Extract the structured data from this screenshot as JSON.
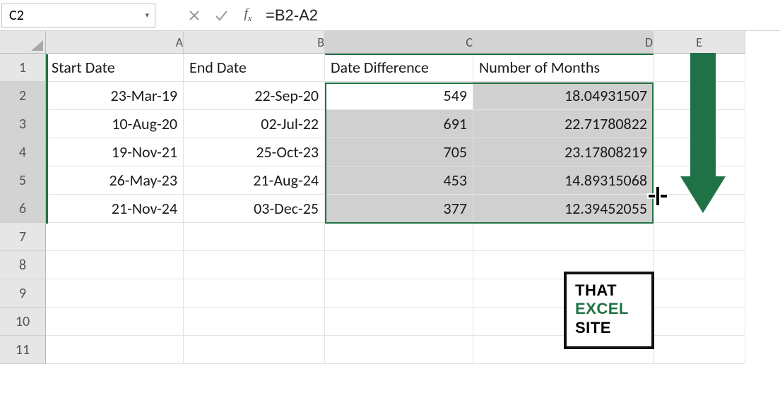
{
  "formula_bar": {
    "cell_ref": "C2",
    "formula": "=B2-A2"
  },
  "columns": [
    "A",
    "B",
    "C",
    "D",
    "E"
  ],
  "row_numbers": [
    "1",
    "2",
    "3",
    "4",
    "5",
    "6",
    "7",
    "8",
    "9",
    "10",
    "11"
  ],
  "headers": {
    "A": "Start Date",
    "B": "End Date",
    "C": "Date Difference",
    "D": "Number of Months"
  },
  "rows": [
    {
      "A": "23-Mar-19",
      "B": "22-Sep-20",
      "C": "549",
      "D": "18.04931507"
    },
    {
      "A": "10-Aug-20",
      "B": "02-Jul-22",
      "C": "691",
      "D": "22.71780822"
    },
    {
      "A": "19-Nov-21",
      "B": "25-Oct-23",
      "C": "705",
      "D": "23.17808219"
    },
    {
      "A": "26-May-23",
      "B": "21-Aug-24",
      "C": "453",
      "D": "14.89315068"
    },
    {
      "A": "21-Nov-24",
      "B": "03-Dec-25",
      "C": "377",
      "D": "12.39452055"
    }
  ],
  "logo": {
    "l1": "THAT",
    "l2": "EXCEL",
    "l3": "SITE"
  },
  "chart_data": {
    "type": "table",
    "title": "Date Difference and Number of Months",
    "columns": [
      "Start Date",
      "End Date",
      "Date Difference",
      "Number of Months"
    ],
    "rows": [
      [
        "23-Mar-19",
        "22-Sep-20",
        549,
        18.04931507
      ],
      [
        "10-Aug-20",
        "02-Jul-22",
        691,
        22.71780822
      ],
      [
        "19-Nov-21",
        "25-Oct-23",
        705,
        23.17808219
      ],
      [
        "26-May-23",
        "21-Aug-24",
        453,
        14.89315068
      ],
      [
        "21-Nov-24",
        "03-Dec-25",
        377,
        12.39452055
      ]
    ]
  }
}
